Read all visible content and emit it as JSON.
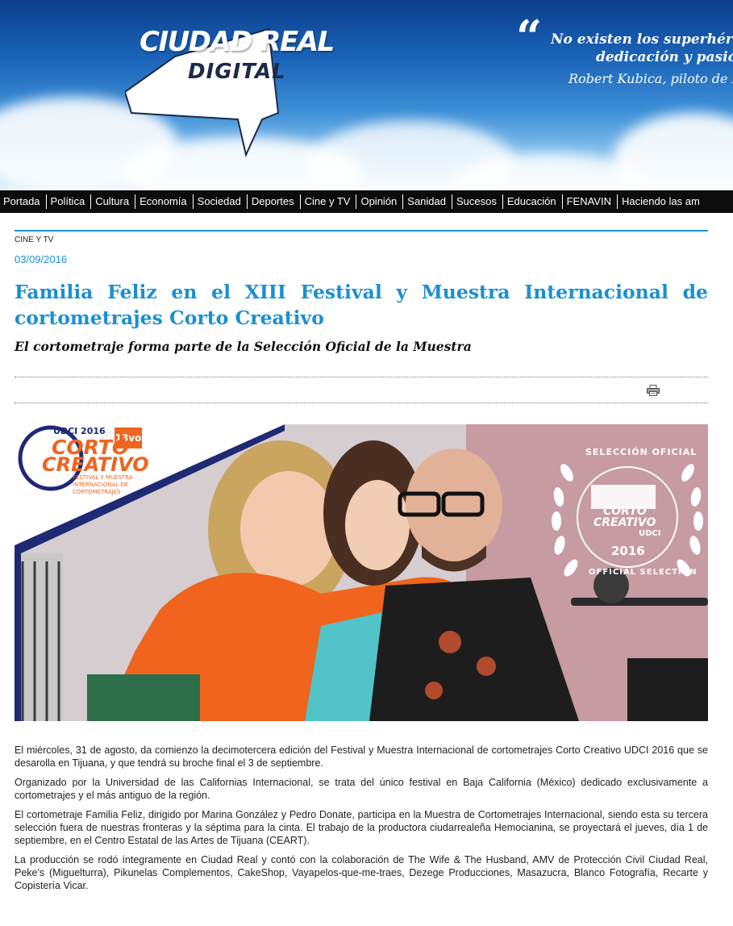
{
  "header": {
    "logo_line1": "CIUDAD REAL",
    "logo_line2": "DIGITAL",
    "quote_line1": "No existen los superhéroes",
    "quote_line2": "dedicación y pasión",
    "quote_author": "Robert Kubica, piloto de F"
  },
  "nav": {
    "items": [
      "Portada",
      "Política",
      "Cultura",
      "Economía",
      "Sociedad",
      "Deportes",
      "Cine y TV",
      "Opinión",
      "Sanidad",
      "Sucesos",
      "Educación",
      "FENAVIN",
      "Haciendo las am"
    ]
  },
  "article": {
    "section": "CINE Y TV",
    "date": "03/09/2016",
    "title": "Familia Feliz en el XIII Festival y Muestra Internacional de cortometrajes Corto Creativo",
    "subtitle": "El cortometraje forma parte de la Selección Oficial de la Muestra",
    "print_icon": "printer-icon",
    "paragraphs": [
      "El miércoles, 31 de agosto, da comienzo la decimotercera edición del Festival y Muestra Internacional de cortometrajes Corto Creativo UDCI 2016 que se desarolla en Tijuana, y que tendrá su broche final el 3 de septiembre.",
      "Organizado por la Universidad de las Californias Internacional, se trata del único festival en Baja California (México) dedicado exclusivamente a cortometrajes y el más antiguo de la región.",
      "El cortometraje Familia Feliz, dirigido por Marina González y Pedro Donate, participa en la Muestra de Cortometrajes Internacional, siendo esta su tercera selección fuera de nuestras fronteras y la séptima para la cinta. El trabajo de la productora ciudarrealeña Hemocianina, se proyectará el jueves, día 1 de septiembre, en el Centro Estatal de las Artes de Tijuana (CEART).",
      "La producción se rodó íntegramente en Ciudad Real y contó con la colaboración de The Wife & The Husband, AMV de Protección Civil Ciudad Real, Peke's (Miguelturra), Pikunelas Complementos, CakeShop, Vayapelos-que-me-traes, Dezege Producciones, Masazucra, Blanco Fotografía, Recarte y Copistería Vicar."
    ]
  },
  "photo": {
    "festival_logo": {
      "year": "UDCI 2016",
      "edition": "13vo",
      "word1": "CORTO",
      "word2": "CREATIVO",
      "tagline1": "FESTIVAL Y MUESTRA",
      "tagline2": "INTERNACIONAL DE",
      "tagline3": "CORTOMETRAJES"
    },
    "seal": {
      "top": "SELECCIÓN OFICIAL",
      "name1": "CORTO",
      "name2": "CREATIVO",
      "org": "UDCI",
      "year": "2016",
      "bottom": "OFFICIAL SELECTION"
    }
  },
  "colors": {
    "accent": "#1b8fd2",
    "nav_bg": "#0c0c0c",
    "orange": "#f0641e"
  }
}
